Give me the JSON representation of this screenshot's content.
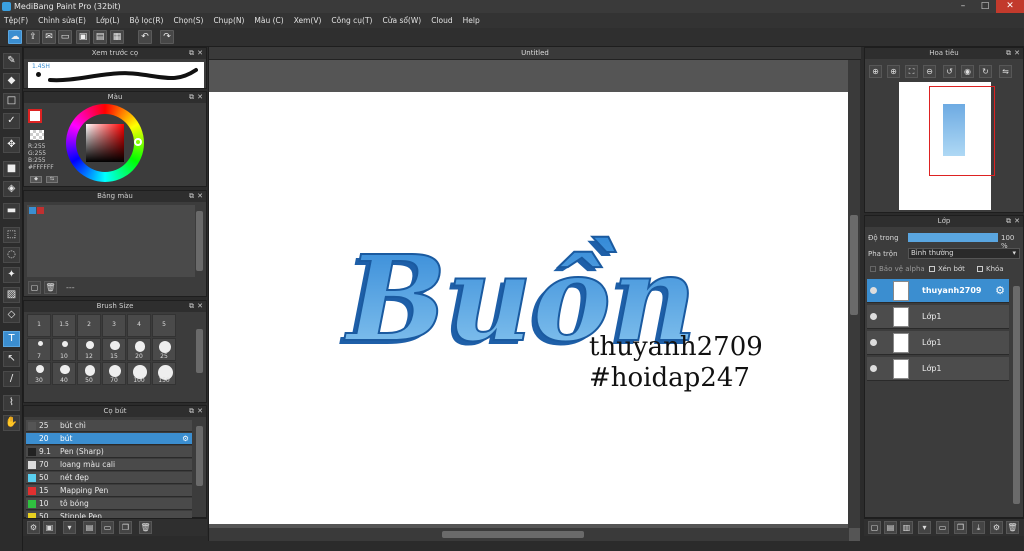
{
  "window": {
    "title": "MediBang Paint Pro (32bit)"
  },
  "menu": [
    "Tệp(F)",
    "Chỉnh sửa(E)",
    "Lớp(L)",
    "Bộ lọc(R)",
    "Chọn(S)",
    "Chụp(N)",
    "Màu (C)",
    "Xem(V)",
    "Công cụ(T)",
    "Cửa sổ(W)",
    "Cloud",
    "Help"
  ],
  "brush_preview": {
    "title": "Xem trước cọ",
    "size": "1.4SH"
  },
  "color_panel": {
    "title": "Màu",
    "r": "R:255",
    "g": "G:255",
    "b": "B:255",
    "hex": "#FFFFFF"
  },
  "palette_panel": {
    "title": "Bảng màu",
    "footer": "---"
  },
  "brush_size_panel": {
    "title": "Brush Size",
    "sizes": [
      "1",
      "1.5",
      "2",
      "3",
      "4",
      "5",
      "7",
      "10",
      "12",
      "15",
      "20",
      "25",
      "30",
      "40",
      "50",
      "70",
      "100",
      "150"
    ]
  },
  "brush_panel": {
    "title": "Cọ bút",
    "items": [
      {
        "size": "25",
        "name": "bút chì",
        "color": "#555555"
      },
      {
        "size": "20",
        "name": "bút",
        "color": "#3b8ed0"
      },
      {
        "size": "9.1",
        "name": "Pen (Sharp)",
        "color": "#222222"
      },
      {
        "size": "70",
        "name": "loang màu cali",
        "color": "#dddddd"
      },
      {
        "size": "50",
        "name": "nét đẹp",
        "color": "#5ad0f0"
      },
      {
        "size": "15",
        "name": "Mapping Pen",
        "color": "#e03030"
      },
      {
        "size": "10",
        "name": "tô bóng",
        "color": "#30c040"
      },
      {
        "size": "50",
        "name": "Stipple Pen",
        "color": "#e8d020"
      }
    ]
  },
  "canvas": {
    "tab": "Untitled",
    "art_word": "Buồn",
    "text_line1": "thuyanh2709",
    "text_line2": "#hoidap247"
  },
  "navigator": {
    "title": "Hoa tiêu"
  },
  "layer_panel": {
    "title": "Lớp",
    "opacity_label": "Độ trong",
    "opacity_value": "100 %",
    "opacity": 1.0,
    "blend_label": "Pha trộn",
    "blend_value": "Bình thường",
    "protect_alpha": "Bảo vệ alpha",
    "clipping": "Xén bớt",
    "lock": "Khóa",
    "layers": [
      {
        "name": "thuyanh2709",
        "selected": true
      },
      {
        "name": "Lớp1",
        "selected": false
      },
      {
        "name": "Lớp1",
        "selected": false
      },
      {
        "name": "Lớp1",
        "selected": false
      }
    ]
  },
  "colors": {
    "accent": "#3b8ed0",
    "letter_blue": "#2f86d6",
    "letter_dark": "#1e5fa8"
  }
}
